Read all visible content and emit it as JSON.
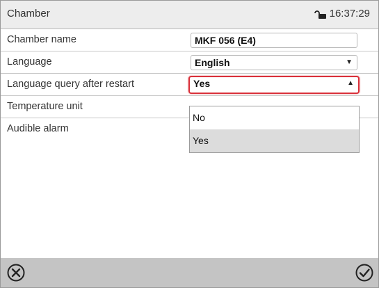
{
  "header": {
    "title": "Chamber",
    "time": "16:37:29"
  },
  "rows": [
    {
      "label": "Chamber name",
      "value": "MKF 056 (E4)"
    },
    {
      "label": "Language",
      "value": "English"
    },
    {
      "label": "Language query after restart",
      "value": "Yes"
    },
    {
      "label": "Temperature unit"
    },
    {
      "label": "Audible alarm"
    }
  ],
  "dropdown": {
    "options": [
      "No",
      "Yes"
    ],
    "selected": "Yes"
  },
  "icons": {
    "header": "lock-icon",
    "cancel": "close-circle-icon",
    "confirm": "check-circle-icon"
  },
  "colors": {
    "focus_border": "#d9303a",
    "header_bg": "#ededed",
    "footer_bg": "#c4c4c4",
    "selected_option_bg": "#dcdcdc"
  }
}
